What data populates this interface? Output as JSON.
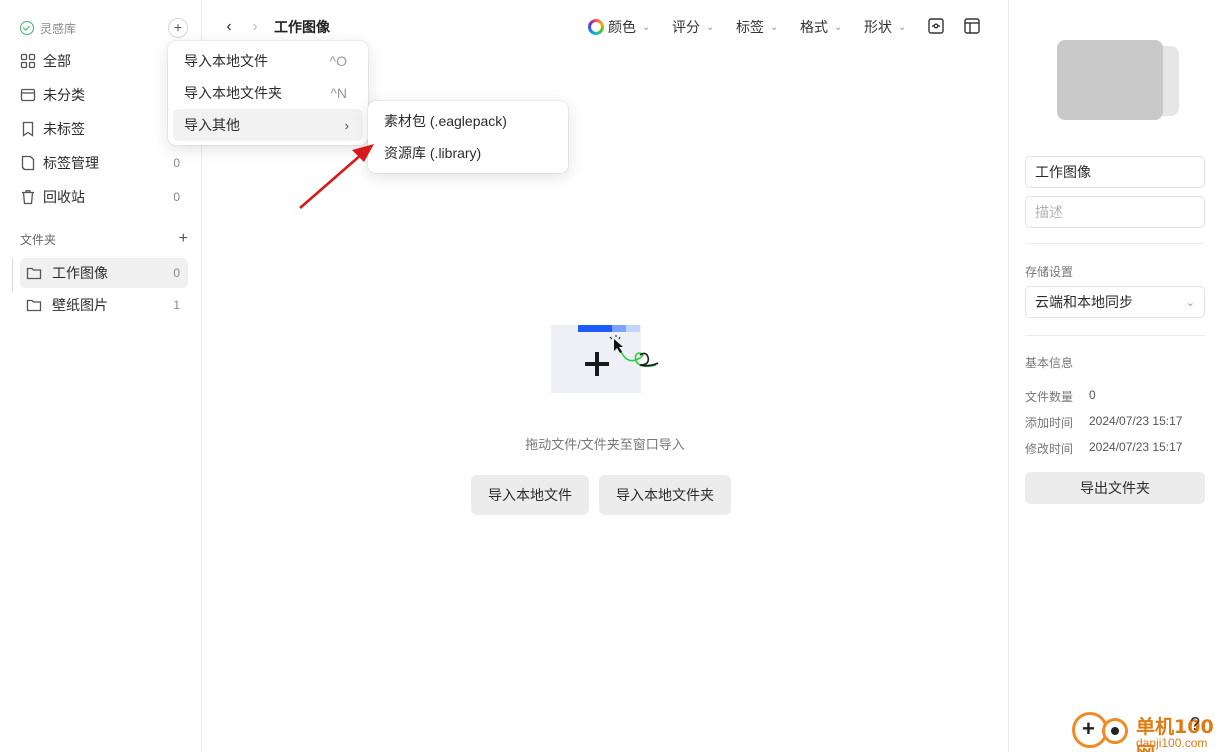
{
  "sidebar": {
    "library_name": "灵感库",
    "add_label": "+",
    "items": [
      {
        "label": "全部",
        "count": ""
      },
      {
        "label": "未分类",
        "count": ""
      },
      {
        "label": "未标签",
        "count": ""
      },
      {
        "label": "标签管理",
        "count": "0"
      },
      {
        "label": "回收站",
        "count": "0"
      }
    ],
    "folders_title": "文件夹",
    "folders_add": "+",
    "folders": [
      {
        "label": "工作图像",
        "count": "0"
      },
      {
        "label": "壁纸图片",
        "count": "1"
      }
    ]
  },
  "toolbar": {
    "back": "‹",
    "forward": "›",
    "title": "工作图像",
    "filters": [
      {
        "label": "颜色",
        "chevron": "⌄"
      },
      {
        "label": "评分",
        "chevron": "⌄"
      },
      {
        "label": "标签",
        "chevron": "⌄"
      },
      {
        "label": "格式",
        "chevron": "⌄"
      },
      {
        "label": "形状",
        "chevron": "⌄"
      }
    ]
  },
  "import_menu": {
    "items": [
      {
        "label": "导入本地文件",
        "shortcut": "^O"
      },
      {
        "label": "导入本地文件夹",
        "shortcut": "^N"
      },
      {
        "label": "导入其他",
        "arrow": "›"
      }
    ],
    "submenu": [
      {
        "label": "素材包 (.eaglepack)"
      },
      {
        "label": "资源库 (.library)"
      }
    ]
  },
  "empty_state": {
    "hint": "拖动文件/文件夹至窗口导入",
    "import_file_button": "导入本地文件",
    "import_folder_button": "导入本地文件夹"
  },
  "right_panel": {
    "name_value": "工作图像",
    "description_placeholder": "描述",
    "storage_label": "存储设置",
    "storage_value": "云端和本地同步",
    "info_title": "基本信息",
    "info": [
      {
        "key": "文件数量",
        "value": "0"
      },
      {
        "key": "添加时间",
        "value": "2024/07/23 15:17"
      },
      {
        "key": "修改时间",
        "value": "2024/07/23 15:17"
      }
    ],
    "export_button": "导出文件夹"
  },
  "watermark": {
    "title": "单机100网",
    "url": "danji100.com"
  },
  "help_label": "?",
  "colors": {
    "accent_blue": "#1f5cff",
    "annotation_arrow": "#d7191c",
    "watermark_orange": "#e07a12",
    "active_bg": "#f0f0f0"
  }
}
